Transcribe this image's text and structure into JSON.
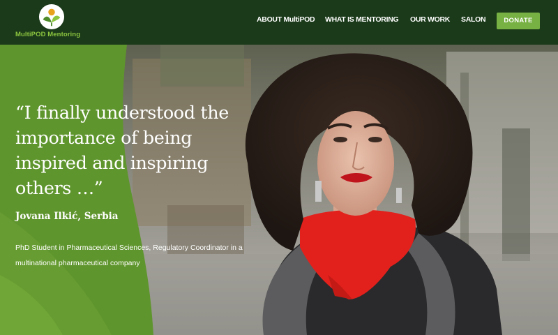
{
  "header": {
    "logo_text": "MultiPOD Mentoring",
    "nav": [
      "ABOUT MultiPOD",
      "WHAT IS MENTORING",
      "OUR WORK",
      "SALON"
    ],
    "donate_label": "DONATE"
  },
  "hero": {
    "quote": "“I finally understood the importance of being inspired and inspiring others …”",
    "author": "Jovana Ilkić, Serbia",
    "role": "PhD Student in Pharmaceutical Sciences, Regulatory Coordinator in a multinational pharmaceutical company"
  },
  "colors": {
    "header_bg": "#1b3a1a",
    "brand_green": "#8cc63f",
    "panel_green": "#5f952d",
    "donate_bg": "#77b043"
  }
}
